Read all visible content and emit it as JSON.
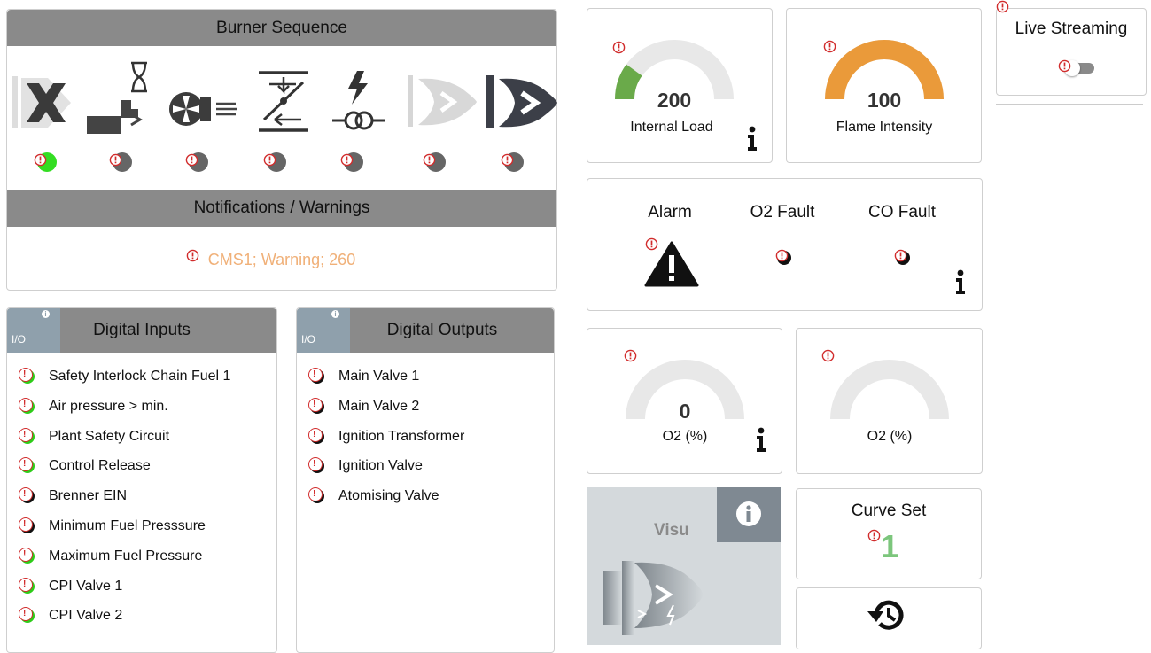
{
  "burner_sequence": {
    "title": "Burner Sequence",
    "steps": [
      {
        "icon": "shutdown-icon",
        "state": "on"
      },
      {
        "icon": "purge-wait-icon",
        "state": "off"
      },
      {
        "icon": "fan-icon",
        "state": "off"
      },
      {
        "icon": "damper-icon",
        "state": "off"
      },
      {
        "icon": "ignition-icon",
        "state": "off"
      },
      {
        "icon": "pilot-flame-icon",
        "state": "off"
      },
      {
        "icon": "main-flame-icon",
        "state": "off"
      }
    ]
  },
  "notifications": {
    "title": "Notifications / Warnings",
    "message": "CMS1; Warning; 260"
  },
  "digital_inputs": {
    "badge": "I/O",
    "title": "Digital Inputs",
    "items": [
      {
        "label": "Safety Interlock Chain Fuel 1",
        "state": "on"
      },
      {
        "label": "Air pressure > min.",
        "state": "on"
      },
      {
        "label": "Plant Safety Circuit",
        "state": "on"
      },
      {
        "label": "Control Release",
        "state": "on"
      },
      {
        "label": "Brenner EIN",
        "state": "off"
      },
      {
        "label": "Minimum Fuel Presssure",
        "state": "off"
      },
      {
        "label": "Maximum Fuel Pressure",
        "state": "on"
      },
      {
        "label": "CPI Valve 1",
        "state": "on"
      },
      {
        "label": "CPI Valve 2",
        "state": "on"
      }
    ]
  },
  "digital_outputs": {
    "badge": "I/O",
    "title": "Digital Outputs",
    "items": [
      {
        "label": "Main Valve 1",
        "state": "off"
      },
      {
        "label": "Main Valve 2",
        "state": "off"
      },
      {
        "label": "Ignition Transformer",
        "state": "off"
      },
      {
        "label": "Ignition Valve",
        "state": "off"
      },
      {
        "label": "Atomising Valve",
        "state": "off"
      }
    ]
  },
  "gauges": {
    "internal_load": {
      "value": "200",
      "label": "Internal Load",
      "fill_fraction": 0.2,
      "color": "#6aaa4a"
    },
    "flame_intensity": {
      "value": "100",
      "label": "Flame Intensity",
      "fill_fraction": 1.0,
      "color": "#ea9a3a"
    },
    "o2_a": {
      "value": "0",
      "label": "O2 (%)",
      "fill_fraction": 0.0
    },
    "o2_b": {
      "value": "",
      "label": "O2 (%)",
      "fill_fraction": 0.0
    }
  },
  "status": {
    "alarm_label": "Alarm",
    "o2_fault_label": "O2 Fault",
    "co_fault_label": "CO Fault"
  },
  "live_streaming": {
    "label": "Live Streaming",
    "enabled": false
  },
  "visu": {
    "label": "Visu"
  },
  "curve_set": {
    "label": "Curve Set",
    "value": "1",
    "value_color": "#7cc67c"
  },
  "colors": {
    "header_bg": "#8a8a8a",
    "warning_red": "#d12c2c",
    "message_orange": "#f0b078"
  }
}
